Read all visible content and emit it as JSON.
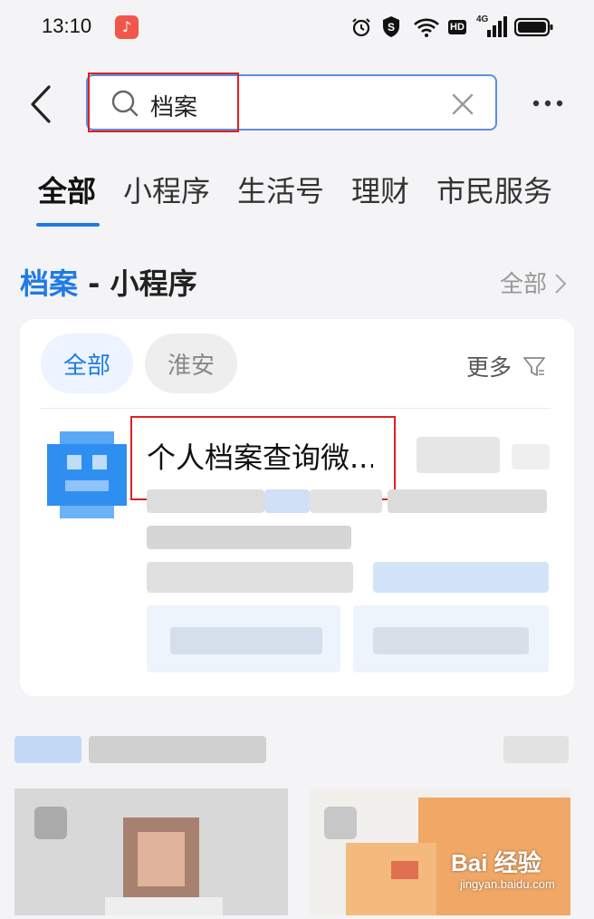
{
  "status_bar": {
    "time": "13:10",
    "music_icon": "music-note-icon",
    "net_badge": "HD",
    "signal_label": "4G"
  },
  "search": {
    "query": "档案",
    "icons": [
      "search-icon",
      "clear-icon",
      "more-icon",
      "back-icon"
    ]
  },
  "tabs": [
    "全部",
    "小程序",
    "生活号",
    "理财",
    "市民服务"
  ],
  "section": {
    "keyword": "档案",
    "suffix": " - 小程序",
    "all_link": "全部"
  },
  "card": {
    "filters": [
      "全部",
      "淮安"
    ],
    "more_filter": "更多",
    "app_title": "个人档案查询微..."
  },
  "watermark": {
    "brand": "Bai 经验",
    "url": "jingyan.baidu.com"
  },
  "colors": {
    "accent": "#1f7ae6",
    "highlight_box": "#e02020",
    "background": "#f4f4f6"
  }
}
